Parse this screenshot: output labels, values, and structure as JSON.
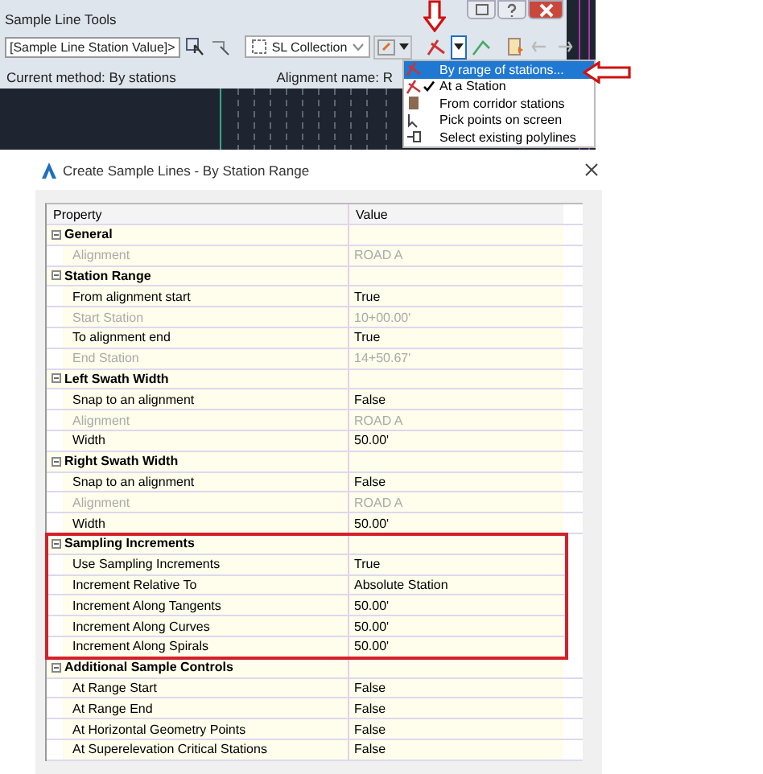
{
  "toolbar": {
    "title": "Sample Line Tools",
    "station_field": "[Sample Line Station Value]>",
    "collection_dropdown": "SL Collection",
    "status_left": "Current method: By stations",
    "status_right": "Alignment name: R"
  },
  "method_menu": {
    "items": [
      {
        "label": "By range of stations...",
        "selected": true,
        "checked": false
      },
      {
        "label": "At a Station",
        "selected": false,
        "checked": true
      },
      {
        "label": "From corridor stations",
        "selected": false,
        "checked": false
      },
      {
        "label": "Pick points on screen",
        "selected": false,
        "checked": false
      },
      {
        "label": "Select existing polylines",
        "selected": false,
        "checked": false
      }
    ]
  },
  "dialog": {
    "title": "Create Sample Lines - By Station Range",
    "columns": [
      "Property",
      "Value"
    ],
    "groups": [
      {
        "name": "General",
        "expanded": true,
        "highlighted": false,
        "rows": [
          {
            "property": "Alignment",
            "value": "ROAD A",
            "disabled": true
          }
        ]
      },
      {
        "name": "Station Range",
        "expanded": true,
        "highlighted": false,
        "rows": [
          {
            "property": "From alignment start",
            "value": "True",
            "disabled": false
          },
          {
            "property": "Start Station",
            "value": "10+00.00'",
            "disabled": true
          },
          {
            "property": "To alignment end",
            "value": "True",
            "disabled": false
          },
          {
            "property": "End Station",
            "value": "14+50.67'",
            "disabled": true
          }
        ]
      },
      {
        "name": "Left Swath Width",
        "expanded": true,
        "highlighted": false,
        "rows": [
          {
            "property": "Snap to an alignment",
            "value": "False",
            "disabled": false
          },
          {
            "property": "Alignment",
            "value": "ROAD A",
            "disabled": true
          },
          {
            "property": "Width",
            "value": "50.00'",
            "disabled": false
          }
        ]
      },
      {
        "name": "Right Swath Width",
        "expanded": true,
        "highlighted": false,
        "rows": [
          {
            "property": "Snap to an alignment",
            "value": "False",
            "disabled": false
          },
          {
            "property": "Alignment",
            "value": "ROAD A",
            "disabled": true
          },
          {
            "property": "Width",
            "value": "50.00'",
            "disabled": false
          }
        ]
      },
      {
        "name": "Sampling Increments",
        "expanded": true,
        "highlighted": true,
        "rows": [
          {
            "property": "Use Sampling Increments",
            "value": "True",
            "disabled": false
          },
          {
            "property": "Increment Relative To",
            "value": "Absolute Station",
            "disabled": false
          },
          {
            "property": "Increment Along Tangents",
            "value": "50.00'",
            "disabled": false
          },
          {
            "property": "Increment Along Curves",
            "value": "50.00'",
            "disabled": false
          },
          {
            "property": "Increment Along Spirals",
            "value": "50.00'",
            "disabled": false
          }
        ]
      },
      {
        "name": "Additional Sample Controls",
        "expanded": true,
        "highlighted": false,
        "rows": [
          {
            "property": "At Range Start",
            "value": "False",
            "disabled": false
          },
          {
            "property": "At Range End",
            "value": "False",
            "disabled": false
          },
          {
            "property": "At Horizontal Geometry Points",
            "value": "False",
            "disabled": false
          },
          {
            "property": "At Superelevation Critical Stations",
            "value": "False",
            "disabled": false
          }
        ]
      }
    ]
  }
}
